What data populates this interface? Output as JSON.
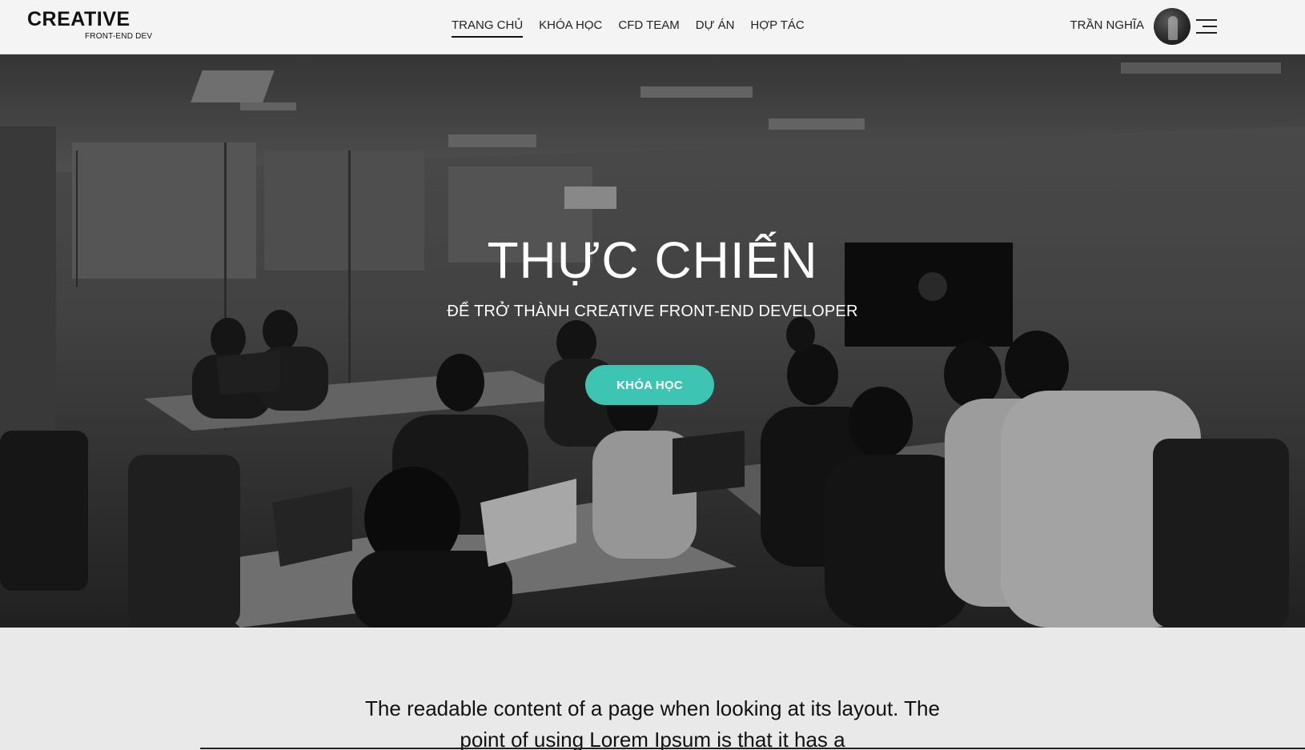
{
  "logo": {
    "main": "CREATIVE",
    "sub": "FRONT-END DEV"
  },
  "nav": {
    "items": [
      {
        "label": "TRANG CHỦ",
        "active": true
      },
      {
        "label": "KHÓA HỌC"
      },
      {
        "label": "CFD TEAM"
      },
      {
        "label": "DỰ ÁN"
      },
      {
        "label": "HỢP TÁC"
      }
    ]
  },
  "user": {
    "name": "TRẦN NGHĨA"
  },
  "hero": {
    "title": "THỰC CHIẾN",
    "subtitle": "ĐỂ TRỞ THÀNH CREATIVE FRONT-END DEVELOPER",
    "button": "KHÓA HỌC"
  },
  "intro": {
    "text": "The readable content of a page when looking at its layout. The point of using Lorem Ipsum is that it has a"
  },
  "colors": {
    "accent": "#3ec4b3",
    "header_bg": "#f3f4f3",
    "page_bg": "#e9e9e9"
  },
  "icons": {
    "menu": "hamburger-menu-icon",
    "avatar": "user-avatar"
  }
}
